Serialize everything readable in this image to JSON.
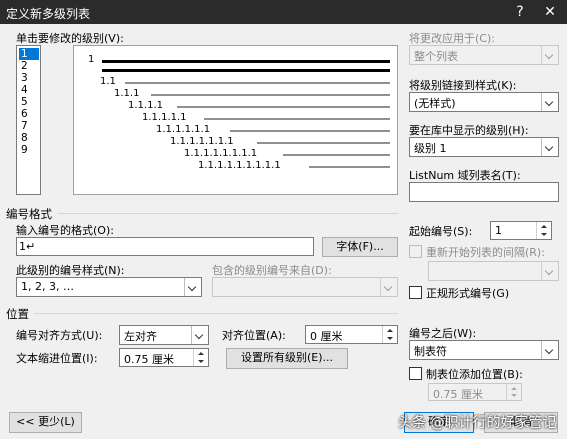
{
  "window": {
    "title": "定义新多级列表",
    "close_glyph": "✕",
    "help_glyph": "?"
  },
  "level_select": {
    "label": "单击要修改的级别(V):",
    "levels": [
      "1",
      "2",
      "3",
      "4",
      "5",
      "6",
      "7",
      "8",
      "9"
    ],
    "selected": "1"
  },
  "preview": {
    "rows": [
      {
        "label": "1"
      },
      {
        "label": "1.1"
      },
      {
        "label": "1.1.1"
      },
      {
        "label": "1.1.1.1"
      },
      {
        "label": "1.1.1.1.1"
      },
      {
        "label": "1.1.1.1.1.1"
      },
      {
        "label": "1.1.1.1.1.1.1"
      },
      {
        "label": "1.1.1.1.1.1.1.1"
      },
      {
        "label": "1.1.1.1.1.1.1.1.1"
      }
    ]
  },
  "right_panel": {
    "apply_to_label": "将更改应用于(C):",
    "apply_to_value": "整个列表",
    "link_style_label": "将级别链接到样式(K):",
    "link_style_value": "(无样式)",
    "gallery_level_label": "要在库中显示的级别(H):",
    "gallery_level_value": "级别 1",
    "listnum_label": "ListNum 域列表名(T):",
    "listnum_value": ""
  },
  "number_format": {
    "group_label": "编号格式",
    "format_label": "输入编号的格式(O):",
    "format_value": "1↵",
    "font_button": "字体(F)...",
    "style_label": "此级别的编号样式(N):",
    "style_value": "1, 2, 3, …",
    "include_label": "包含的级别编号来自(D):",
    "include_value": "",
    "start_at_label": "起始编号(S):",
    "start_at_value": "1",
    "restart_label": "重新开始列表的间隔(R):",
    "restart_value": "",
    "legal_label": "正规形式编号(G)"
  },
  "position": {
    "group_label": "位置",
    "align_label": "编号对齐方式(U):",
    "align_value": "左对齐",
    "align_at_label": "对齐位置(A):",
    "align_at_value": "0 厘米",
    "indent_label": "文本缩进位置(I):",
    "indent_value": "0.75 厘米",
    "set_all_button": "设置所有级别(E)...",
    "follow_label": "编号之后(W):",
    "follow_value": "制表符",
    "tab_stop_label": "制表位添加位置(B):",
    "tab_stop_value": "0.75 厘米"
  },
  "footer": {
    "less_button": "<< 更少(L)",
    "ok_button": "确定",
    "cancel_button": "取消",
    "watermark": "头条 @职计行的好家管记"
  }
}
